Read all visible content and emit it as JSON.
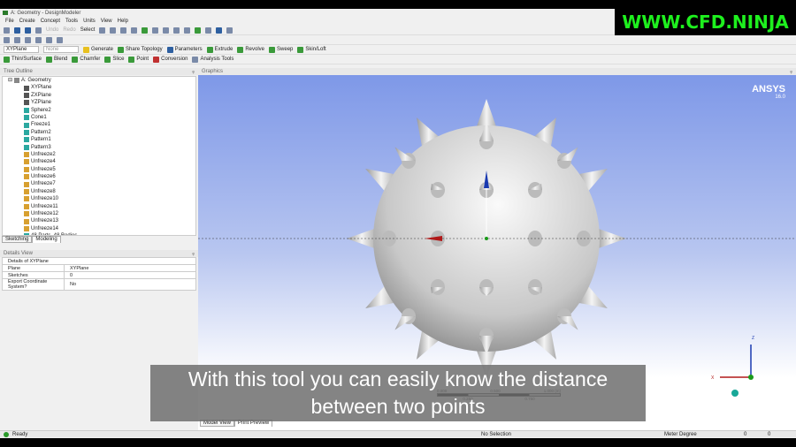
{
  "window": {
    "title": "A: Geometry - DesignModeler"
  },
  "menu": [
    "File",
    "Create",
    "Concept",
    "Tools",
    "Units",
    "View",
    "Help"
  ],
  "toolbar1": {
    "undo": "Undo",
    "redo": "Redo",
    "select": "Select"
  },
  "toolbar3": {
    "plane": "XYPlane",
    "sketch": "None",
    "generate": "Generate",
    "share_topology": "Share Topology",
    "parameters": "Parameters",
    "extrude": "Extrude",
    "revolve": "Revolve",
    "sweep": "Sweep",
    "skin_loft": "Skin/Loft"
  },
  "toolbar4": {
    "thin_surface": "Thin/Surface",
    "blend": "Blend",
    "chamfer": "Chamfer",
    "slice": "Slice",
    "point": "Point",
    "conversion": "Conversion",
    "analysis_tools": "Analysis Tools"
  },
  "tree": {
    "title": "Tree Outline",
    "root": "A: Geometry",
    "items": [
      "XYPlane",
      "ZXPlane",
      "YZPlane",
      "Sphere2",
      "Cone1",
      "Freeze1",
      "Pattern2",
      "Pattern1",
      "Pattern3",
      "Unfreeze2",
      "Unfreeze4",
      "Unfreeze5",
      "Unfreeze6",
      "Unfreeze7",
      "Unfreeze8",
      "Unfreeze10",
      "Unfreeze11",
      "Unfreeze12",
      "Unfreeze13",
      "Unfreeze14",
      "48 Parts, 48 Bodies"
    ]
  },
  "tabs": [
    "Sketching",
    "Modeling"
  ],
  "details": {
    "title": "Details View",
    "header": "Details of XYPlane",
    "rows": [
      [
        "Plane",
        "XYPlane"
      ],
      [
        "Sketches",
        "0"
      ],
      [
        "Export Coordinate System?",
        "No"
      ]
    ]
  },
  "graphics": {
    "title": "Graphics",
    "brand": "ANSYS",
    "version": "16.0",
    "scale": {
      "t0": "0.000",
      "t1": "0.500",
      "t2": "1.000 (m)",
      "b1": "0.250",
      "b2": "0.750"
    },
    "view_tabs": [
      "Model View",
      "Print Preview"
    ]
  },
  "status": {
    "ready": "Ready",
    "selection": "No Selection",
    "units": "Meter  Degree",
    "v1": "0",
    "v2": "0"
  },
  "subtitle": "With this tool you can easily know the distance between two points",
  "watermark": "WWW.CFD.NINJA"
}
